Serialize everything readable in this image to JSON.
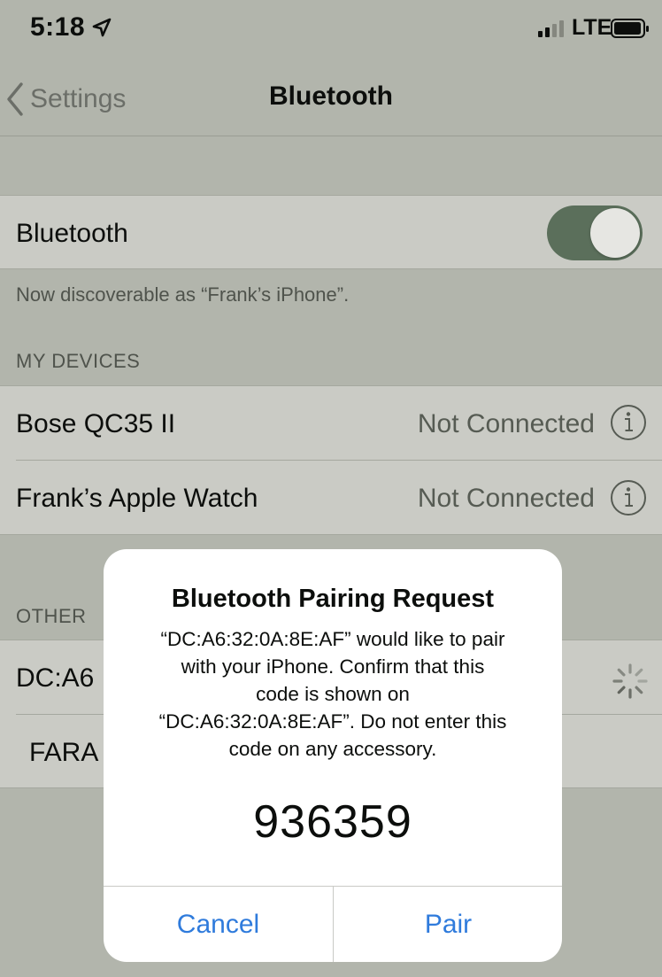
{
  "status_bar": {
    "time": "5:18",
    "location_icon": "location-arrow-icon",
    "carrier": "LTE",
    "signal_bars_filled": 2,
    "signal_bars_total": 4,
    "battery_level": 0.8
  },
  "nav": {
    "back_label": "Settings",
    "title": "Bluetooth"
  },
  "bluetooth_row": {
    "label": "Bluetooth",
    "toggle_on": true
  },
  "discoverable_note": "Now discoverable as “Frank’s iPhone”.",
  "my_devices": {
    "header": "MY DEVICES",
    "items": [
      {
        "name": "Bose QC35 II",
        "status": "Not Connected"
      },
      {
        "name": "Frank’s Apple Watch",
        "status": "Not Connected"
      }
    ]
  },
  "other_devices": {
    "header": "OTHER",
    "items": [
      {
        "name": "DC:A6"
      },
      {
        "name": "FARA"
      }
    ]
  },
  "alert": {
    "title": "Bluetooth Pairing Request",
    "message_lines": [
      "“DC:A6:32:0A:8E:AF” would like to pair",
      "with your iPhone. Confirm that this",
      "code is shown on",
      "“DC:A6:32:0A:8E:AF”. Do not enter this",
      "code on any accessory."
    ],
    "code": "936359",
    "cancel_label": "Cancel",
    "pair_label": "Pair"
  },
  "colors": {
    "dim_background": "#b2b5ac",
    "row_background": "#cacbc5",
    "toggle_on": "#5b6f5b",
    "alert_button": "#2f7bdc"
  }
}
